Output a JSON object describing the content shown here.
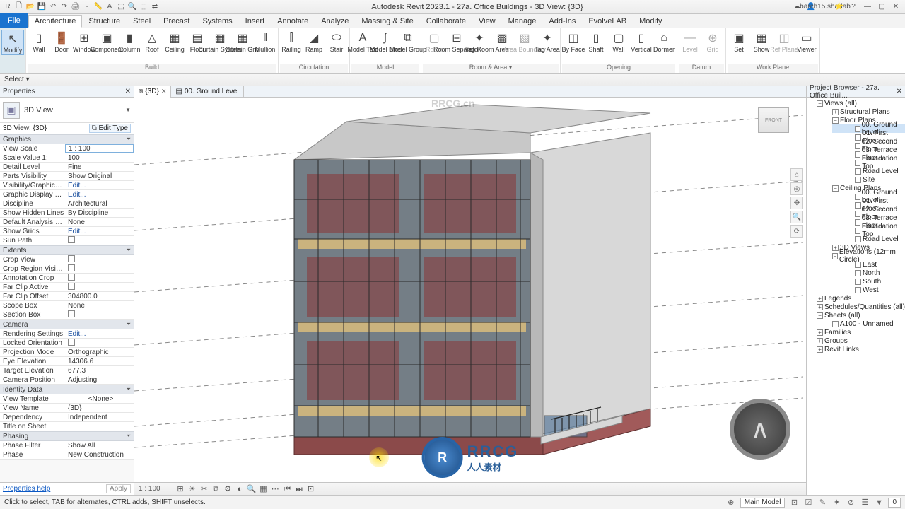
{
  "titlebar": {
    "center": "Autodesk Revit 2023.1 - 27a. Office Buildings - 3D View: {3D}",
    "user": "barch15.shadab",
    "qat": [
      "R",
      "🗋",
      "📂",
      "💾",
      "↶",
      "↷",
      "🖨",
      "✎",
      "·",
      "📏",
      "A",
      "⬚",
      "🔍",
      "⬚",
      "⇄"
    ]
  },
  "tabs": [
    "File",
    "Architecture",
    "Structure",
    "Steel",
    "Precast",
    "Systems",
    "Insert",
    "Annotate",
    "Analyze",
    "Massing & Site",
    "Collaborate",
    "View",
    "Manage",
    "Add-Ins",
    "EvolveLAB",
    "Modify"
  ],
  "active_tab": "Architecture",
  "ribbon": {
    "groups": [
      {
        "name": "",
        "items": [
          {
            "label": "Modify",
            "glyph": "↖",
            "selected": true
          }
        ],
        "cls": "modify"
      },
      {
        "name": "Build",
        "items": [
          {
            "label": "Wall",
            "glyph": "▯"
          },
          {
            "label": "Door",
            "glyph": "🚪"
          },
          {
            "label": "Window",
            "glyph": "⊞"
          },
          {
            "label": "Component",
            "glyph": "▣"
          },
          {
            "label": "Column",
            "glyph": "▮"
          },
          {
            "label": "Roof",
            "glyph": "△"
          },
          {
            "label": "Ceiling",
            "glyph": "▦"
          },
          {
            "label": "Floor",
            "glyph": "▤"
          },
          {
            "label": "Curtain System",
            "glyph": "▦"
          },
          {
            "label": "Curtain Grid",
            "glyph": "▦"
          },
          {
            "label": "Mullion",
            "glyph": "‖"
          }
        ]
      },
      {
        "name": "Circulation",
        "items": [
          {
            "label": "Railing",
            "glyph": "⫿"
          },
          {
            "label": "Ramp",
            "glyph": "◢"
          },
          {
            "label": "Stair",
            "glyph": "⬭"
          }
        ]
      },
      {
        "name": "Model",
        "items": [
          {
            "label": "Model Text",
            "glyph": "A"
          },
          {
            "label": "Model Line",
            "glyph": "∫"
          },
          {
            "label": "Model Group",
            "glyph": "⧉"
          }
        ]
      },
      {
        "name": "Room & Area ▾",
        "items": [
          {
            "label": "Room",
            "glyph": "▢",
            "dimmed": true
          },
          {
            "label": "Room Separator",
            "glyph": "⊟"
          },
          {
            "label": "Tag Room",
            "glyph": "✦",
            "yellow": true
          },
          {
            "label": "Area",
            "glyph": "▩",
            "yellow": true
          },
          {
            "label": "Area Boundary",
            "glyph": "▧",
            "dimmed": true
          },
          {
            "label": "Tag Area",
            "glyph": "✦",
            "yellow": true
          }
        ]
      },
      {
        "name": "Opening",
        "items": [
          {
            "label": "By Face",
            "glyph": "◫"
          },
          {
            "label": "Shaft",
            "glyph": "▯"
          },
          {
            "label": "Wall",
            "glyph": "▢"
          },
          {
            "label": "Vertical",
            "glyph": "▯"
          },
          {
            "label": "Dormer",
            "glyph": "⌂"
          }
        ]
      },
      {
        "name": "Datum",
        "items": [
          {
            "label": "Level",
            "glyph": "—",
            "dimmed": true
          },
          {
            "label": "Grid",
            "glyph": "⊕",
            "dimmed": true
          }
        ]
      },
      {
        "name": "Work Plane",
        "items": [
          {
            "label": "Set",
            "glyph": "▣"
          },
          {
            "label": "Show",
            "glyph": "▦"
          },
          {
            "label": "Ref Plane",
            "glyph": "◫",
            "dimmed": true
          },
          {
            "label": "Viewer",
            "glyph": "▭"
          }
        ]
      }
    ]
  },
  "select_dropdown": "Select ▾",
  "properties": {
    "title": "Properties",
    "type_label": "3D View",
    "view_selector": "3D View: {3D}",
    "edit_type": "Edit Type",
    "sections": [
      {
        "name": "Graphics",
        "rows": [
          {
            "k": "View Scale",
            "v": "1 : 100",
            "input": true
          },
          {
            "k": "Scale Value   1:",
            "v": "100"
          },
          {
            "k": "Detail Level",
            "v": "Fine"
          },
          {
            "k": "Parts Visibility",
            "v": "Show Original"
          },
          {
            "k": "Visibility/Graphics Ov...",
            "v": "Edit...",
            "link": true
          },
          {
            "k": "Graphic Display Optio...",
            "v": "Edit...",
            "link": true
          },
          {
            "k": "Discipline",
            "v": "Architectural"
          },
          {
            "k": "Show Hidden Lines",
            "v": "By Discipline"
          },
          {
            "k": "Default Analysis Displ...",
            "v": "None"
          },
          {
            "k": "Show Grids",
            "v": "Edit...",
            "link": true
          },
          {
            "k": "Sun Path",
            "v": "",
            "cb": true
          }
        ]
      },
      {
        "name": "Extents",
        "rows": [
          {
            "k": "Crop View",
            "v": "",
            "cb": true
          },
          {
            "k": "Crop Region Visible",
            "v": "",
            "cb": true
          },
          {
            "k": "Annotation Crop",
            "v": "",
            "cb": true
          },
          {
            "k": "Far Clip Active",
            "v": "",
            "cb": true
          },
          {
            "k": "Far Clip Offset",
            "v": "304800.0"
          },
          {
            "k": "Scope Box",
            "v": "None"
          },
          {
            "k": "Section Box",
            "v": "",
            "cb": true
          }
        ]
      },
      {
        "name": "Camera",
        "rows": [
          {
            "k": "Rendering Settings",
            "v": "Edit...",
            "link": true
          },
          {
            "k": "Locked Orientation",
            "v": "",
            "cb": true
          },
          {
            "k": "Projection Mode",
            "v": "Orthographic"
          },
          {
            "k": "Eye Elevation",
            "v": "14306.6"
          },
          {
            "k": "Target Elevation",
            "v": "677.3"
          },
          {
            "k": "Camera Position",
            "v": "Adjusting"
          }
        ]
      },
      {
        "name": "Identity Data",
        "rows": [
          {
            "k": "View Template",
            "v": "<None>",
            "centered": true
          },
          {
            "k": "View Name",
            "v": "{3D}"
          },
          {
            "k": "Dependency",
            "v": "Independent"
          },
          {
            "k": "Title on Sheet",
            "v": ""
          }
        ]
      },
      {
        "name": "Phasing",
        "rows": [
          {
            "k": "Phase Filter",
            "v": "Show All"
          },
          {
            "k": "Phase",
            "v": "New Construction"
          }
        ]
      }
    ],
    "help": "Properties help",
    "apply": "Apply"
  },
  "doctabs": [
    {
      "label": "{3D}",
      "active": true
    },
    {
      "label": "00. Ground Level",
      "active": false
    }
  ],
  "browser": {
    "title": "Project Browser - 27a. Office Buil...",
    "views_all": "Views (all)",
    "structural_plans": "Structural Plans",
    "floor_plans": "Floor Plans",
    "fp_items": [
      "00. Ground Level",
      "01. First Floor",
      "02. Second Floor",
      "03. Terrace Floor",
      "Foundation Top",
      "Road Level",
      "Site"
    ],
    "ceiling_plans": "Ceiling Plans",
    "cp_items": [
      "00. Ground Level",
      "01. First Floor",
      "02. Second Floor",
      "03. Terrace Floor",
      "Foundation Top",
      "Road Level"
    ],
    "three_d": "3D Views",
    "elev": "Elevations (12mm Circle)",
    "elev_items": [
      "East",
      "North",
      "South",
      "West"
    ],
    "legends": "Legends",
    "schedules": "Schedules/Quantities (all)",
    "sheets": "Sheets (all)",
    "sheet_item": "A100 - Unnamed",
    "families": "Families",
    "groups": "Groups",
    "revit_links": "Revit Links"
  },
  "viewcontrol": {
    "scale": "1 : 100",
    "icons": [
      "⊞",
      "☀",
      "✂",
      "⧉",
      "⚙",
      "◐",
      "🔍",
      "▦",
      "⋯",
      "⏮",
      "⏭",
      "⊡"
    ]
  },
  "statusbar": {
    "hint": "Click to select, TAB for alternates, CTRL adds, SHIFT unselects.",
    "model": "Main Model",
    "icons": [
      "⊕",
      "⊡",
      "☑",
      "✎",
      "✦",
      "⊘",
      "☰",
      "⧉",
      "▼",
      "0"
    ]
  },
  "viewcube": "FRONT",
  "rrcg": {
    "big": "RRCG",
    "small": "人人素材"
  },
  "watermark": "RRCG.cn"
}
